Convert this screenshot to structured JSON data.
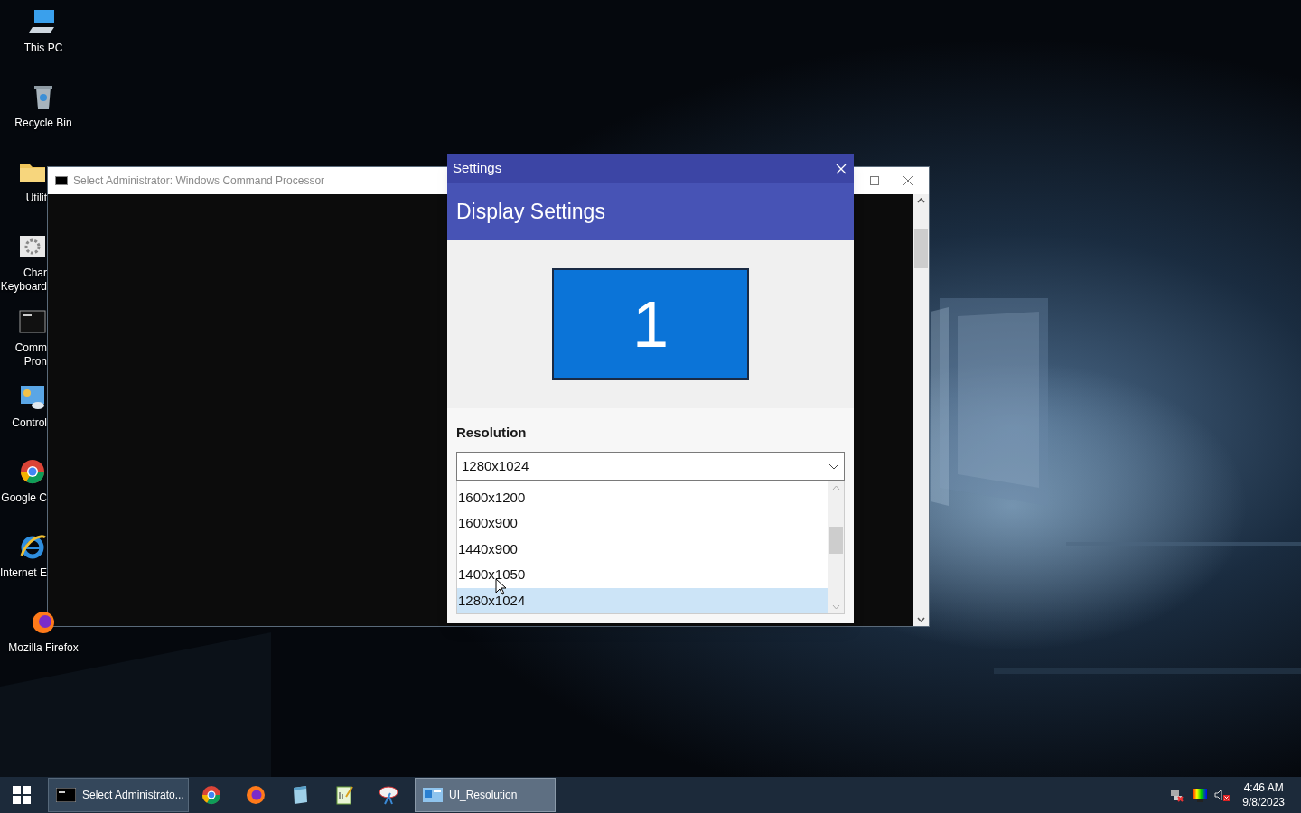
{
  "desktop_icons": [
    {
      "lines": [
        "This PC"
      ],
      "clipped": false
    },
    {
      "lines": [
        "Recycle Bin"
      ],
      "clipped": false
    },
    {
      "lines": [
        "Utilit"
      ],
      "clipped": true
    },
    {
      "lines": [
        "Char",
        "Keyboard"
      ],
      "clipped": true
    },
    {
      "lines": [
        "Comm",
        "Pron"
      ],
      "clipped": true
    },
    {
      "lines": [
        "Control"
      ],
      "clipped": true
    },
    {
      "lines": [
        "Google C"
      ],
      "clipped": true
    },
    {
      "lines": [
        "Internet E"
      ],
      "clipped": true
    },
    {
      "lines": [
        "Mozilla Firefox"
      ],
      "clipped": false
    }
  ],
  "cmd_window": {
    "title": "Select Administrator: Windows Command Processor"
  },
  "settings": {
    "title": "Settings",
    "heading": "Display Settings",
    "monitor_label": "1",
    "section_label": "Resolution",
    "combo_value": "1280x1024",
    "options": [
      {
        "label": "1600x1200",
        "selected": false
      },
      {
        "label": "1600x900",
        "selected": false
      },
      {
        "label": "1440x900",
        "selected": false
      },
      {
        "label": "1400x1050",
        "selected": false
      },
      {
        "label": "1280x1024",
        "selected": true
      }
    ]
  },
  "taskbar": {
    "tasks": [
      {
        "kind": "window",
        "label": "Select Administrato...",
        "active": false
      },
      {
        "kind": "pinned"
      },
      {
        "kind": "pinned"
      },
      {
        "kind": "pinned"
      },
      {
        "kind": "pinned"
      },
      {
        "kind": "pinned"
      },
      {
        "kind": "window",
        "label": "UI_Resolution",
        "active": true
      }
    ],
    "time": "4:46 AM",
    "date": "9/8/2023"
  }
}
